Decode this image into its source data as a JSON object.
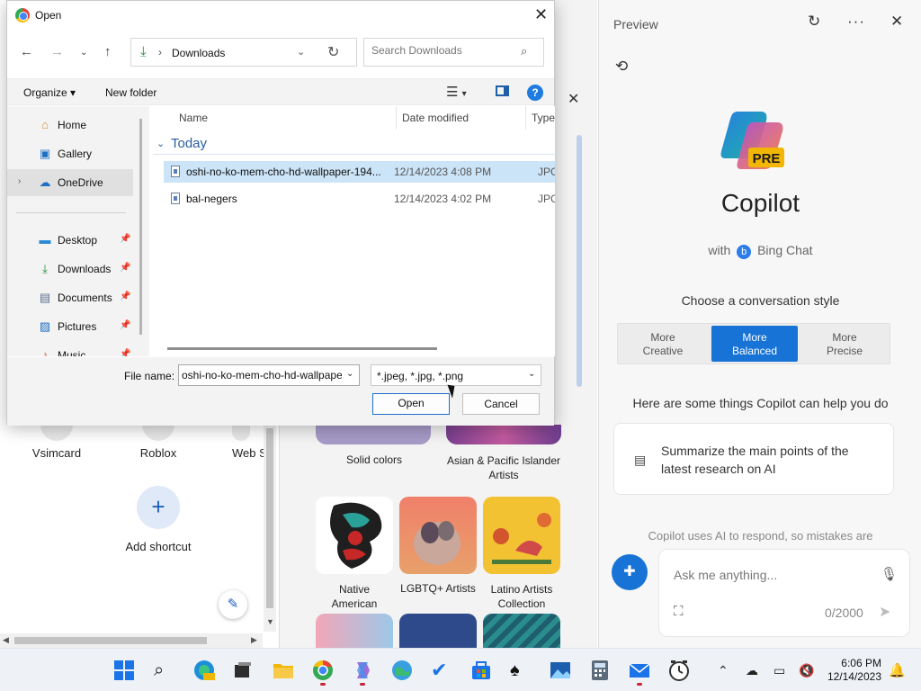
{
  "background": {
    "tiles": [
      "Vsimcard",
      "Roblox",
      "Web S"
    ],
    "add_shortcut": "Add shortcut",
    "themes": [
      {
        "label": "Solid colors"
      },
      {
        "label": "Asian & Pacific Islander Artists"
      },
      {
        "label": "Native American Artists"
      },
      {
        "label": "LGBTQ+ Artists"
      },
      {
        "label": "Latino Artists Collection"
      }
    ]
  },
  "copilot": {
    "header_title": "Preview",
    "brand": "Copilot",
    "logo_badge": "PRE",
    "with_prefix": "with",
    "bing_chat": "Bing Chat",
    "choose_style": "Choose a conversation style",
    "styles": [
      {
        "line1": "More",
        "line2": "Creative",
        "active": false
      },
      {
        "line1": "More",
        "line2": "Balanced",
        "active": true
      },
      {
        "line1": "More",
        "line2": "Precise",
        "active": false
      }
    ],
    "help_heading": "Here are some things Copilot can help you do",
    "suggestion": "Summarize the main points of the latest research on AI",
    "disclaimer": "Copilot uses AI to respond, so mistakes are",
    "input_placeholder": "Ask me anything...",
    "char_count": "0/2000",
    "accent_color": "#1773d6"
  },
  "dialog": {
    "title": "Open",
    "breadcrumb": "Downloads",
    "search_placeholder": "Search Downloads",
    "toolbar": {
      "organize": "Organize",
      "new_folder": "New folder"
    },
    "nav_items": [
      {
        "label": "Home",
        "icon": "home-icon"
      },
      {
        "label": "Gallery",
        "icon": "gallery-icon"
      },
      {
        "label": "OneDrive",
        "icon": "onedrive-icon"
      },
      {
        "label": "Desktop",
        "icon": "desktop-icon"
      },
      {
        "label": "Downloads",
        "icon": "downloads-icon"
      },
      {
        "label": "Documents",
        "icon": "documents-icon"
      },
      {
        "label": "Pictures",
        "icon": "pictures-icon"
      },
      {
        "label": "Music",
        "icon": "music-icon"
      }
    ],
    "columns": {
      "name": "Name",
      "date": "Date modified",
      "type": "Type"
    },
    "group": "Today",
    "files": [
      {
        "name": "oshi-no-ko-mem-cho-hd-wallpaper-194...",
        "date": "12/14/2023 4:08 PM",
        "type": "JPG F",
        "selected": true
      },
      {
        "name": "bal-negers",
        "date": "12/14/2023 4:02 PM",
        "type": "JPG F",
        "selected": false
      }
    ],
    "file_name_label": "File name:",
    "file_name_value": "oshi-no-ko-mem-cho-hd-wallpaper",
    "file_type": "*.jpeg, *.jpg, *.png",
    "open_label": "Open",
    "cancel_label": "Cancel"
  },
  "taskbar": {
    "time": "6:06 PM",
    "date": "12/14/2023",
    "apps": [
      "windows-start-icon",
      "search-icon",
      "edge-preview-icon",
      "task-view-icon",
      "file-explorer-icon",
      "chrome-icon",
      "copilot-app-icon",
      "maps-icon",
      "todo-icon",
      "store-icon",
      "solitaire-icon",
      "photos-icon",
      "calculator-icon",
      "mail-icon",
      "clock-icon"
    ]
  }
}
